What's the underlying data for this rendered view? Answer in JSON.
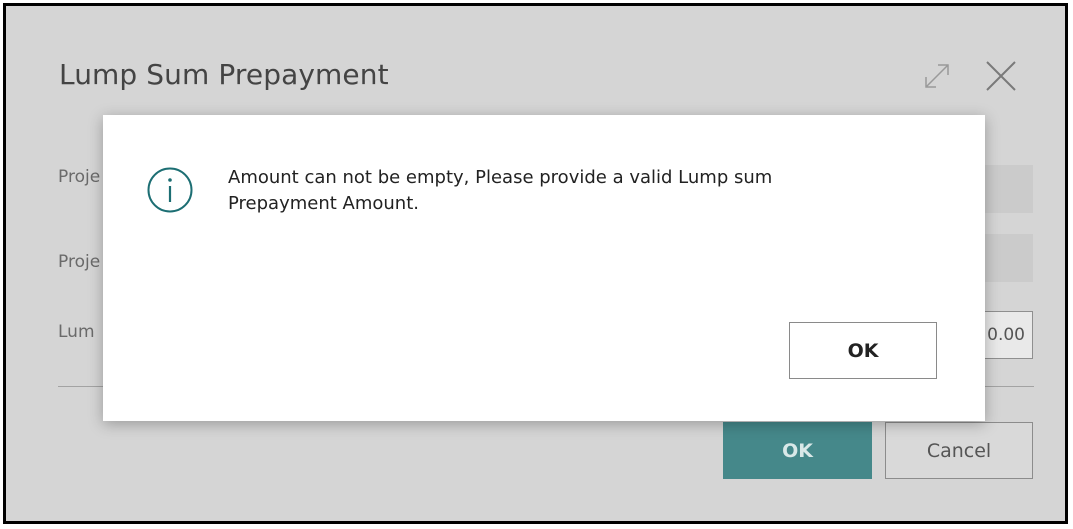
{
  "dialog": {
    "title": "Lump Sum Prepayment",
    "fields": [
      {
        "label": "Proje",
        "value": ""
      },
      {
        "label": "Proje",
        "value": ""
      },
      {
        "label": "Lum",
        "value": "0.00"
      }
    ],
    "ok_label": "OK",
    "cancel_label": "Cancel",
    "icons": {
      "expand": "expand-icon",
      "close": "close-icon"
    }
  },
  "message": {
    "icon": "info-icon",
    "text_line1": "Amount can not be empty, Please provide a valid Lump sum",
    "text_line2": "Prepayment Amount.",
    "ok_label": "OK"
  },
  "colors": {
    "overlay": "#d5d5d5",
    "primary_button": "#45888a",
    "info_icon": "#1c6e73"
  }
}
